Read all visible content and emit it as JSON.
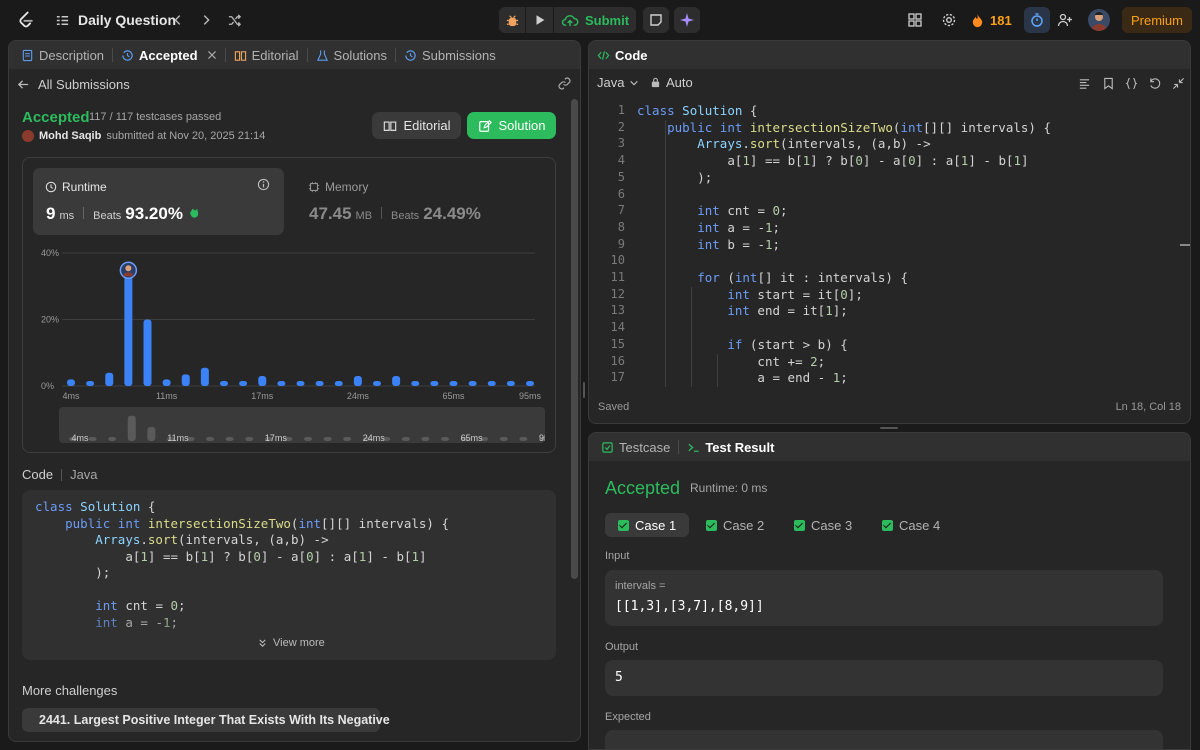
{
  "topbar": {
    "problem_list_label": "Daily Question",
    "submit_label": "Submit",
    "streak_count": "181",
    "premium_label": "Premium"
  },
  "left": {
    "tabs": [
      "Description",
      "Accepted",
      "Editorial",
      "Solutions",
      "Submissions"
    ],
    "back_label": "All Submissions",
    "status": "Accepted",
    "testcases": "117 / 117 testcases passed",
    "user": "Mohd Saqib",
    "submitted_at": "submitted at Nov 20, 2025 21:14",
    "editorial_btn": "Editorial",
    "solution_btn": "Solution",
    "runtime": {
      "label": "Runtime",
      "value": "9",
      "unit": "ms",
      "beats_label": "Beats",
      "beats": "93.20%"
    },
    "memory": {
      "label": "Memory",
      "value": "47.45",
      "unit": "MB",
      "beats_label": "Beats",
      "beats": "24.49%"
    },
    "code_label": "Code",
    "lang_label": "Java",
    "code_preview": [
      "class Solution {",
      "    public int intersectionSizeTwo(int[][] intervals) {",
      "        Arrays.sort(intervals, (a,b) ->",
      "            a[1] == b[1] ? b[0] - a[0] : a[1] - b[1]",
      "        );",
      "",
      "        int cnt = 0;",
      "        int a = -1;"
    ],
    "view_more": "View more",
    "more_challenges_label": "More challenges",
    "challenge": "2441. Largest Positive Integer That Exists With Its Negative"
  },
  "chart_data": {
    "type": "bar",
    "ylabel_ticks": [
      "40%",
      "20%",
      "0%"
    ],
    "ylim": [
      0,
      40
    ],
    "x_tick_labels": [
      "4ms",
      "11ms",
      "17ms",
      "24ms",
      "65ms",
      "95ms"
    ],
    "values": [
      2,
      1.5,
      4,
      36,
      20,
      2,
      3.5,
      5.5,
      1.5,
      1.5,
      3,
      1.5,
      1.5,
      1.5,
      1.5,
      3,
      1.5,
      3,
      1.5,
      1.5,
      1.5,
      1.5,
      1.5,
      1.5,
      1.5
    ],
    "highlight_index": 3,
    "minimap_labels": [
      "4ms",
      "11ms",
      "17ms",
      "24ms",
      "65ms",
      "95ms"
    ]
  },
  "editor": {
    "title": "Code",
    "language": "Java",
    "mode": "Auto",
    "lines": [
      "class Solution {",
      "    public int intersectionSizeTwo(int[][] intervals) {",
      "        Arrays.sort(intervals, (a,b) ->",
      "            a[1] == b[1] ? b[0] - a[0] : a[1] - b[1]",
      "        );",
      "",
      "        int cnt = 0;",
      "        int a = -1;",
      "        int b = -1;",
      "",
      "        for (int[] it : intervals) {",
      "            int start = it[0];",
      "            int end = it[1];",
      "",
      "            if (start > b) {",
      "                cnt += 2;",
      "                a = end - 1;"
    ],
    "saved_label": "Saved",
    "cursor": "Ln 18, Col 18"
  },
  "testpanel": {
    "tab_testcase": "Testcase",
    "tab_result": "Test Result",
    "status": "Accepted",
    "runtime": "Runtime: 0 ms",
    "cases": [
      "Case 1",
      "Case 2",
      "Case 3",
      "Case 4"
    ],
    "input_label": "Input",
    "input_var": "intervals =",
    "input_value": "[[1,3],[3,7],[8,9]]",
    "output_label": "Output",
    "output_value": "5",
    "expected_label": "Expected"
  },
  "colors": {
    "accent_green": "#2cbb5d",
    "bar_blue": "#3b82f6",
    "orange": "#ffa116"
  }
}
